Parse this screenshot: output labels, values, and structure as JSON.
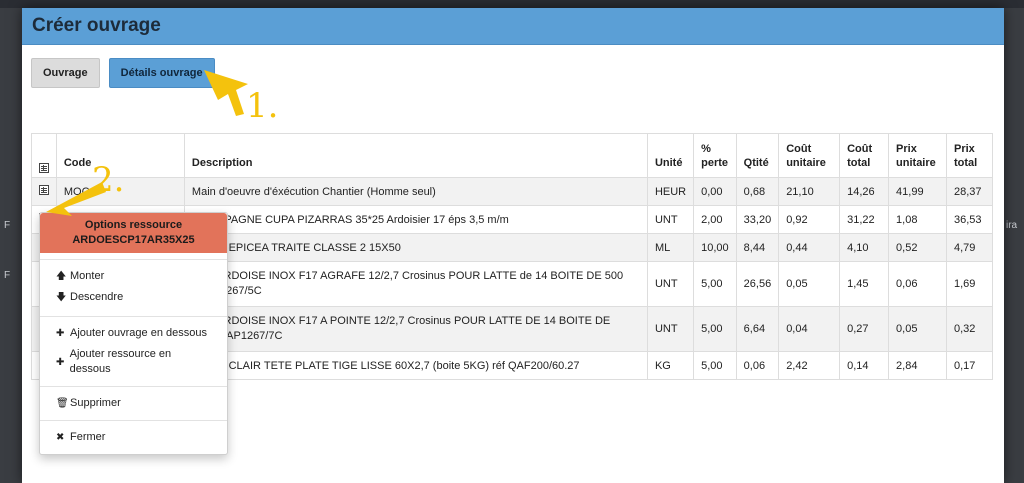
{
  "modal": {
    "title": "Créer ouvrage",
    "tabs": [
      {
        "label": "Ouvrage",
        "active": false
      },
      {
        "label": "Détails ouvrage",
        "active": true
      }
    ]
  },
  "table": {
    "headers": {
      "code": "Code",
      "description": "Description",
      "unite": "Unité",
      "perte": "% perte",
      "qtite": "Qtité",
      "cout_unitaire": "Coût unitaire",
      "cout_total": "Coût total",
      "prix_unitaire": "Prix unitaire",
      "prix_total": "Prix total"
    },
    "rows": [
      {
        "code": "MOC",
        "description": "Main d'oeuvre d'éxécution Chantier (Homme seul)",
        "unite": "HEUR",
        "perte": "0,00",
        "qtite": "0,68",
        "cout_unitaire": "21,10",
        "cout_total": "14,26",
        "prix_unitaire": "41,99",
        "prix_total": "28,37"
      },
      {
        "code": "",
        "description": "SE ESPAGNE CUPA PIZARRAS 35*25 Ardoisier 17 éps 3,5 m/m",
        "unite": "UNT",
        "perte": "2,00",
        "qtite": "33,20",
        "cout_unitaire": "0,92",
        "cout_total": "31,22",
        "prix_unitaire": "1,08",
        "prix_total": "36,53"
      },
      {
        "code": "",
        "description": "SAPIN-EPICEA TRAITE CLASSE 2 15X50",
        "unite": "ML",
        "perte": "10,00",
        "qtite": "8,44",
        "cout_unitaire": "0,44",
        "cout_total": "4,10",
        "prix_unitaire": "0,52",
        "prix_total": "4,79"
      },
      {
        "code": "",
        "description_l1": "HET ARDOISE INOX F17 AGRAFE 12/2,7 Crosinus POUR LATTE de 14 BOITE DE 500",
        "description_l2": "AFAA1267/5C",
        "unite": "UNT",
        "perte": "5,00",
        "qtite": "26,56",
        "cout_unitaire": "0,05",
        "cout_total": "1,45",
        "prix_unitaire": "0,06",
        "prix_total": "1,69"
      },
      {
        "code": "",
        "description_l1": "HET ARDOISE INOX F17 A POINTE 12/2,7 Crosinus POUR LATTE DE 14 BOITE DE",
        "description_l2": "éf QAFAP1267/7C",
        "unite": "UNT",
        "perte": "5,00",
        "qtite": "6,64",
        "cout_unitaire": "0,04",
        "cout_total": "0,27",
        "prix_unitaire": "0,05",
        "prix_total": "0,32"
      },
      {
        "code": "",
        "description": "ACIER CLAIR TETE PLATE TIGE LISSE 60X2,7 (boite 5KG) réf QAF200/60.27",
        "unite": "KG",
        "perte": "5,00",
        "qtite": "0,06",
        "cout_unitaire": "2,42",
        "cout_total": "0,14",
        "prix_unitaire": "2,84",
        "prix_total": "0,17"
      }
    ]
  },
  "context_menu": {
    "header_line1": "Options ressource",
    "header_line2": "ARDOESCP17AR35X25",
    "items": {
      "monter": "Monter",
      "descendre": "Descendre",
      "ajouter_ouvrage": "Ajouter ouvrage en dessous",
      "ajouter_ressource": "Ajouter ressource en dessous",
      "supprimer": "Supprimer",
      "fermer": "Fermer"
    }
  },
  "annotations": {
    "step1": "1.",
    "step2": "2.",
    "color": "#f4c20d"
  },
  "background": {
    "left_marks": [
      "F",
      "F"
    ],
    "right_mark": "ira"
  }
}
